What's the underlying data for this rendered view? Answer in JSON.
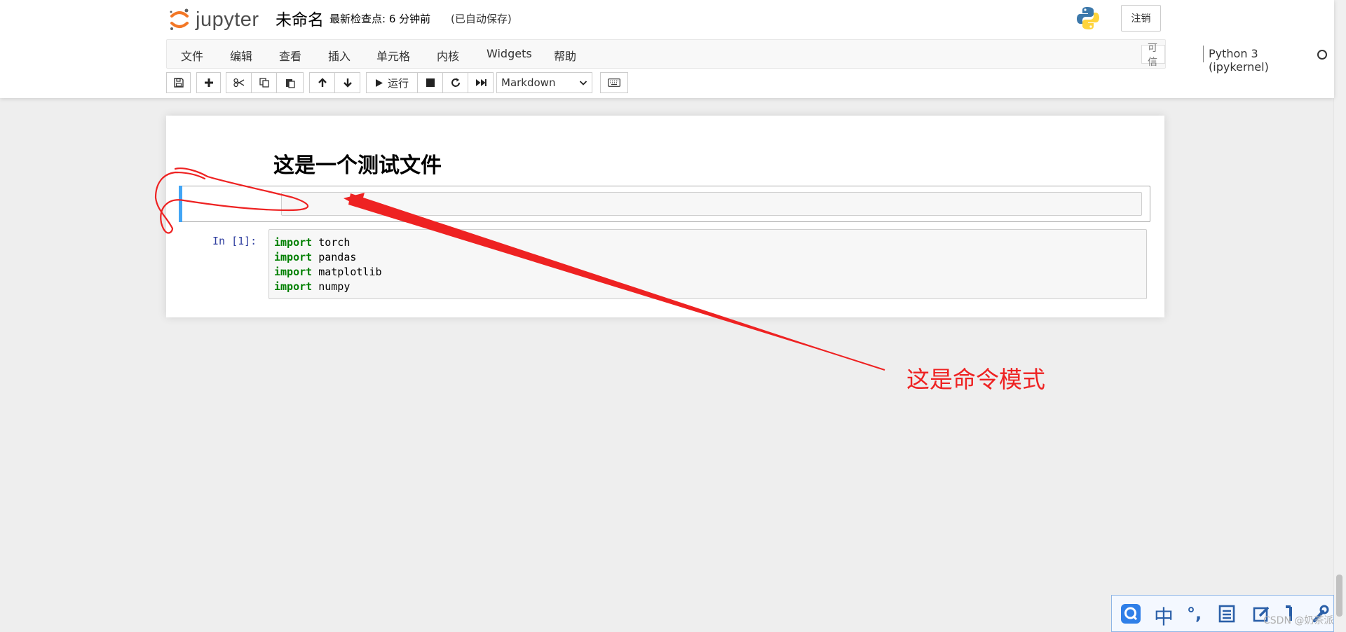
{
  "header": {
    "logo_text": "jupyter",
    "notebook_name": "未命名",
    "checkpoint": "最新检查点: 6 分钟前",
    "autosave": "(已自动保存)",
    "logout_label": "注销"
  },
  "menubar": {
    "items": [
      "文件",
      "编辑",
      "查看",
      "插入",
      "单元格",
      "内核",
      "Widgets",
      "帮助"
    ],
    "trusted_label": "可信",
    "kernel_name": "Python 3 (ipykernel)"
  },
  "toolbar": {
    "run_label": "运行",
    "cell_type": "Markdown"
  },
  "notebook": {
    "heading": "这是一个测试文件",
    "prompt": "In  [1]:",
    "code_lines": [
      {
        "keyword": "import",
        "module": "torch"
      },
      {
        "keyword": "import",
        "module": "pandas"
      },
      {
        "keyword": "import",
        "module": "matplotlib"
      },
      {
        "keyword": "import",
        "module": "numpy"
      }
    ]
  },
  "annotation": {
    "text": "这是命令模式",
    "color": "#ee2222"
  },
  "ime": {
    "chinese_label": "中",
    "punct_label": "°,"
  },
  "watermark": "CSDN @奶茶派",
  "colors": {
    "selected_bar": "#42a5f5",
    "keyword": "#008000",
    "prompt": "#303f9f",
    "jupyter_orange": "#f37726"
  }
}
